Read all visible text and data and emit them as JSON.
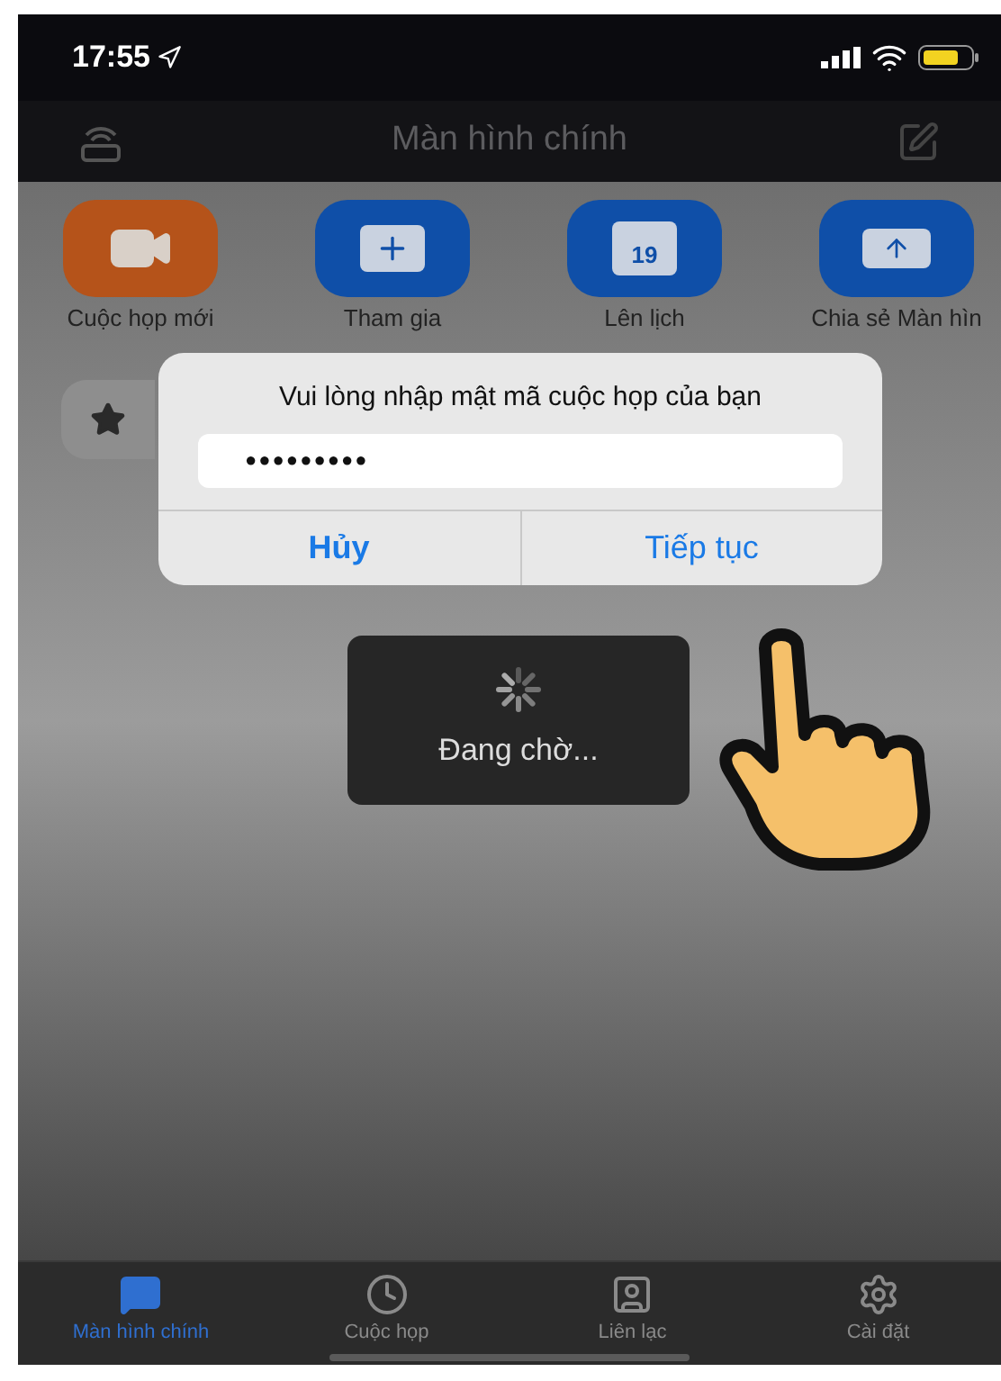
{
  "status_bar": {
    "time": "17:55"
  },
  "header": {
    "title": "Màn hình chính"
  },
  "actions": [
    {
      "kind": "video",
      "label": "Cuộc họp mới",
      "color": "#b5531a"
    },
    {
      "kind": "join",
      "label": "Tham gia",
      "color": "#0f4fa8"
    },
    {
      "kind": "calendar",
      "label": "Lên lịch",
      "color": "#0f4fa8",
      "icon_text": "19"
    },
    {
      "kind": "share",
      "label": "Chia sẻ Màn hìn",
      "color": "#0f4fa8"
    }
  ],
  "dialog": {
    "message": "Vui lòng nhập mật mã cuộc họp của bạn",
    "password": "●●●●●●●●●",
    "buttons": [
      "Hủy",
      "Tiếp tục"
    ]
  },
  "loading": {
    "text": "Đang chờ..."
  },
  "tabs": [
    {
      "kind": "home",
      "label": "Màn hình chính",
      "selected": true
    },
    {
      "kind": "meetings",
      "label": "Cuộc họp",
      "selected": false
    },
    {
      "kind": "contacts",
      "label": "Liên lạc",
      "selected": false
    },
    {
      "kind": "settings",
      "label": "Cài đặt",
      "selected": false
    }
  ]
}
